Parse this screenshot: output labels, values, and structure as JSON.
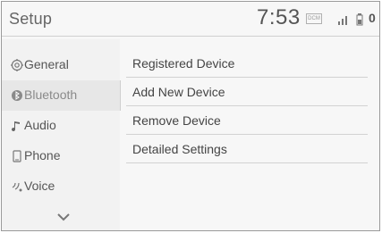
{
  "header": {
    "title": "Setup",
    "clock": "7:53",
    "status_badge": "DCM",
    "status_digit": "0"
  },
  "sidebar": {
    "items": [
      {
        "label": "General",
        "icon": "gear-icon"
      },
      {
        "label": "Bluetooth",
        "icon": "bluetooth-icon",
        "selected": true
      },
      {
        "label": "Audio",
        "icon": "music-note-icon"
      },
      {
        "label": "Phone",
        "icon": "phone-icon"
      },
      {
        "label": "Voice",
        "icon": "voice-icon"
      }
    ]
  },
  "menu": {
    "items": [
      {
        "label": "Registered Device"
      },
      {
        "label": "Add New Device"
      },
      {
        "label": "Remove Device"
      },
      {
        "label": "Detailed Settings"
      }
    ]
  }
}
